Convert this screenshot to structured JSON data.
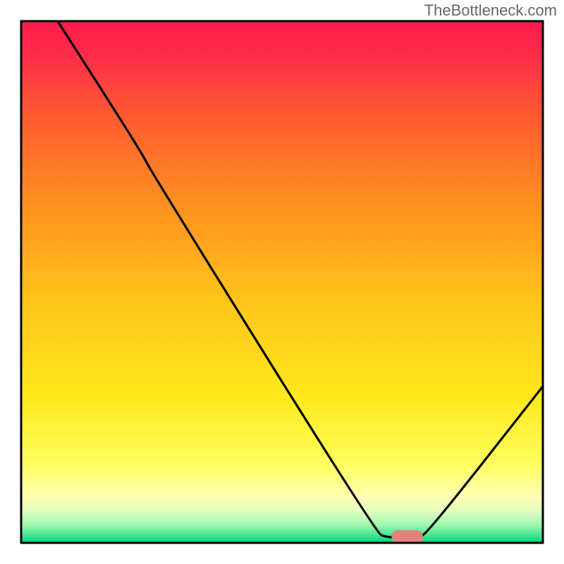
{
  "watermark": "TheBottleneck.com",
  "chart_data": {
    "type": "line",
    "title": "",
    "xlabel": "",
    "ylabel": "",
    "xlim": [
      0,
      100
    ],
    "ylim": [
      0,
      100
    ],
    "gradient_background": {
      "top": "#ff2050",
      "mid_upper": "#ff9020",
      "mid": "#ffe020",
      "mid_lower": "#ffff80",
      "near_bottom": "#c0ffb0",
      "bottom": "#00e080"
    },
    "curve_points": [
      {
        "x": 7,
        "y": 100
      },
      {
        "x": 23,
        "y": 75
      },
      {
        "x": 25,
        "y": 71
      },
      {
        "x": 68,
        "y": 2
      },
      {
        "x": 70,
        "y": 1
      },
      {
        "x": 76,
        "y": 1
      },
      {
        "x": 78,
        "y": 2
      },
      {
        "x": 100,
        "y": 30
      }
    ],
    "marker": {
      "x0": 71,
      "x1": 77,
      "y": 1.2,
      "color": "#e6807a"
    },
    "annotations": []
  }
}
